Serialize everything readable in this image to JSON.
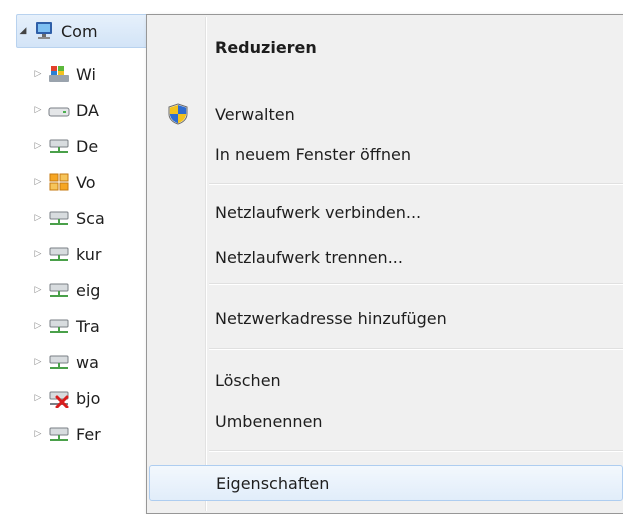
{
  "tree": {
    "root": {
      "label": "Com",
      "icon": "computer-icon",
      "arrow": "◢"
    },
    "items": [
      {
        "label": "Wi",
        "icon": "windows-drive-icon"
      },
      {
        "label": "DA",
        "icon": "hard-drive-icon"
      },
      {
        "label": "De",
        "icon": "network-drive-icon"
      },
      {
        "label": "Vo",
        "icon": "folder-drive-icon"
      },
      {
        "label": "Sca",
        "icon": "network-drive-icon"
      },
      {
        "label": "kur",
        "icon": "network-drive-icon"
      },
      {
        "label": "eig",
        "icon": "network-drive-icon"
      },
      {
        "label": "Tra",
        "icon": "network-drive-icon"
      },
      {
        "label": "wa",
        "icon": "network-drive-icon"
      },
      {
        "label": "bjo",
        "icon": "disconnected-drive-icon"
      },
      {
        "label": "Fer",
        "icon": "network-drive-icon"
      }
    ]
  },
  "context_menu": {
    "items": [
      {
        "label": "Reduzieren",
        "bold": true
      },
      {
        "label": "Verwalten",
        "icon": "uac-shield-icon"
      },
      {
        "label": "In neuem Fenster öffnen"
      },
      {
        "label": "Netzlaufwerk verbinden..."
      },
      {
        "label": "Netzlaufwerk trennen..."
      },
      {
        "label": "Netzwerkadresse hinzufügen"
      },
      {
        "label": "Löschen"
      },
      {
        "label": "Umbenennen"
      },
      {
        "label": "Eigenschaften",
        "highlighted": true
      }
    ]
  },
  "colors": {
    "selection": "#d3e4f7",
    "menu_background": "#f0f0f0",
    "network_drive_green": "#4aa04a",
    "error_red": "#d81e1e"
  }
}
